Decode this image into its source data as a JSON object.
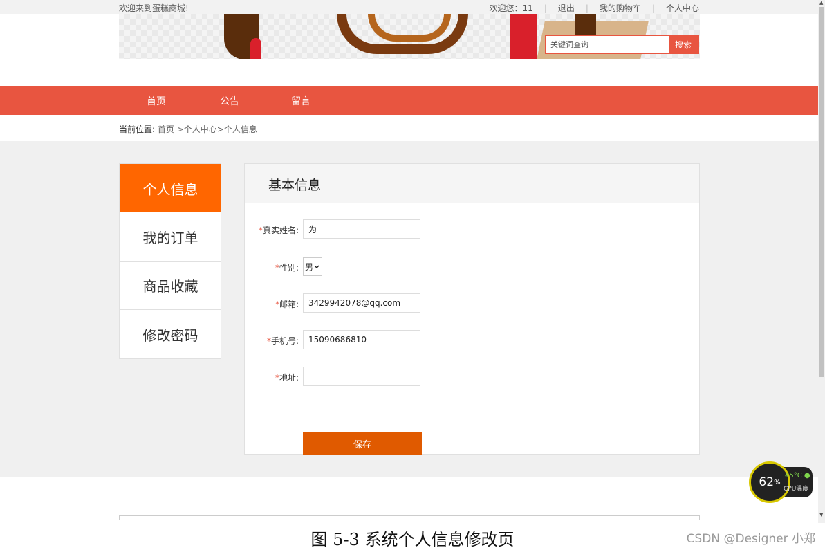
{
  "topbar": {
    "welcome": "欢迎来到蛋糕商城!",
    "greeting": "欢迎您：11",
    "logout": "退出",
    "cart": "我的购物车",
    "center": "个人中心"
  },
  "search": {
    "placeholder": "关键词查询",
    "button": "搜索"
  },
  "nav": [
    "首页",
    "公告",
    "留言"
  ],
  "breadcrumb": {
    "label": "当前位置:",
    "home": "首页",
    "center": ">个人中心",
    "current": ">个人信息"
  },
  "sidebar": [
    "个人信息",
    "我的订单",
    "商品收藏",
    "修改密码"
  ],
  "panel": {
    "title": "基本信息",
    "fields": {
      "name": {
        "label": "真实姓名:",
        "value": "为"
      },
      "gender": {
        "label": "性别:",
        "value": "男"
      },
      "email": {
        "label": "邮箱:",
        "value": "3429942078@qq.com"
      },
      "phone": {
        "label": "手机号:",
        "value": "15090686810"
      },
      "address": {
        "label": "地址:",
        "value": ""
      }
    },
    "required_mark": "*",
    "save": "保存"
  },
  "caption": "图 5-3  系统个人信息修改页",
  "watermark": "CSDN @Designer 小郑",
  "cpu_widget": {
    "percent": "62",
    "percent_unit": "%",
    "temp": "45°C",
    "label": "CPU温度"
  },
  "colors": {
    "accent": "#e85540",
    "active_tab": "#ff6600",
    "save_button": "#e05a00"
  }
}
